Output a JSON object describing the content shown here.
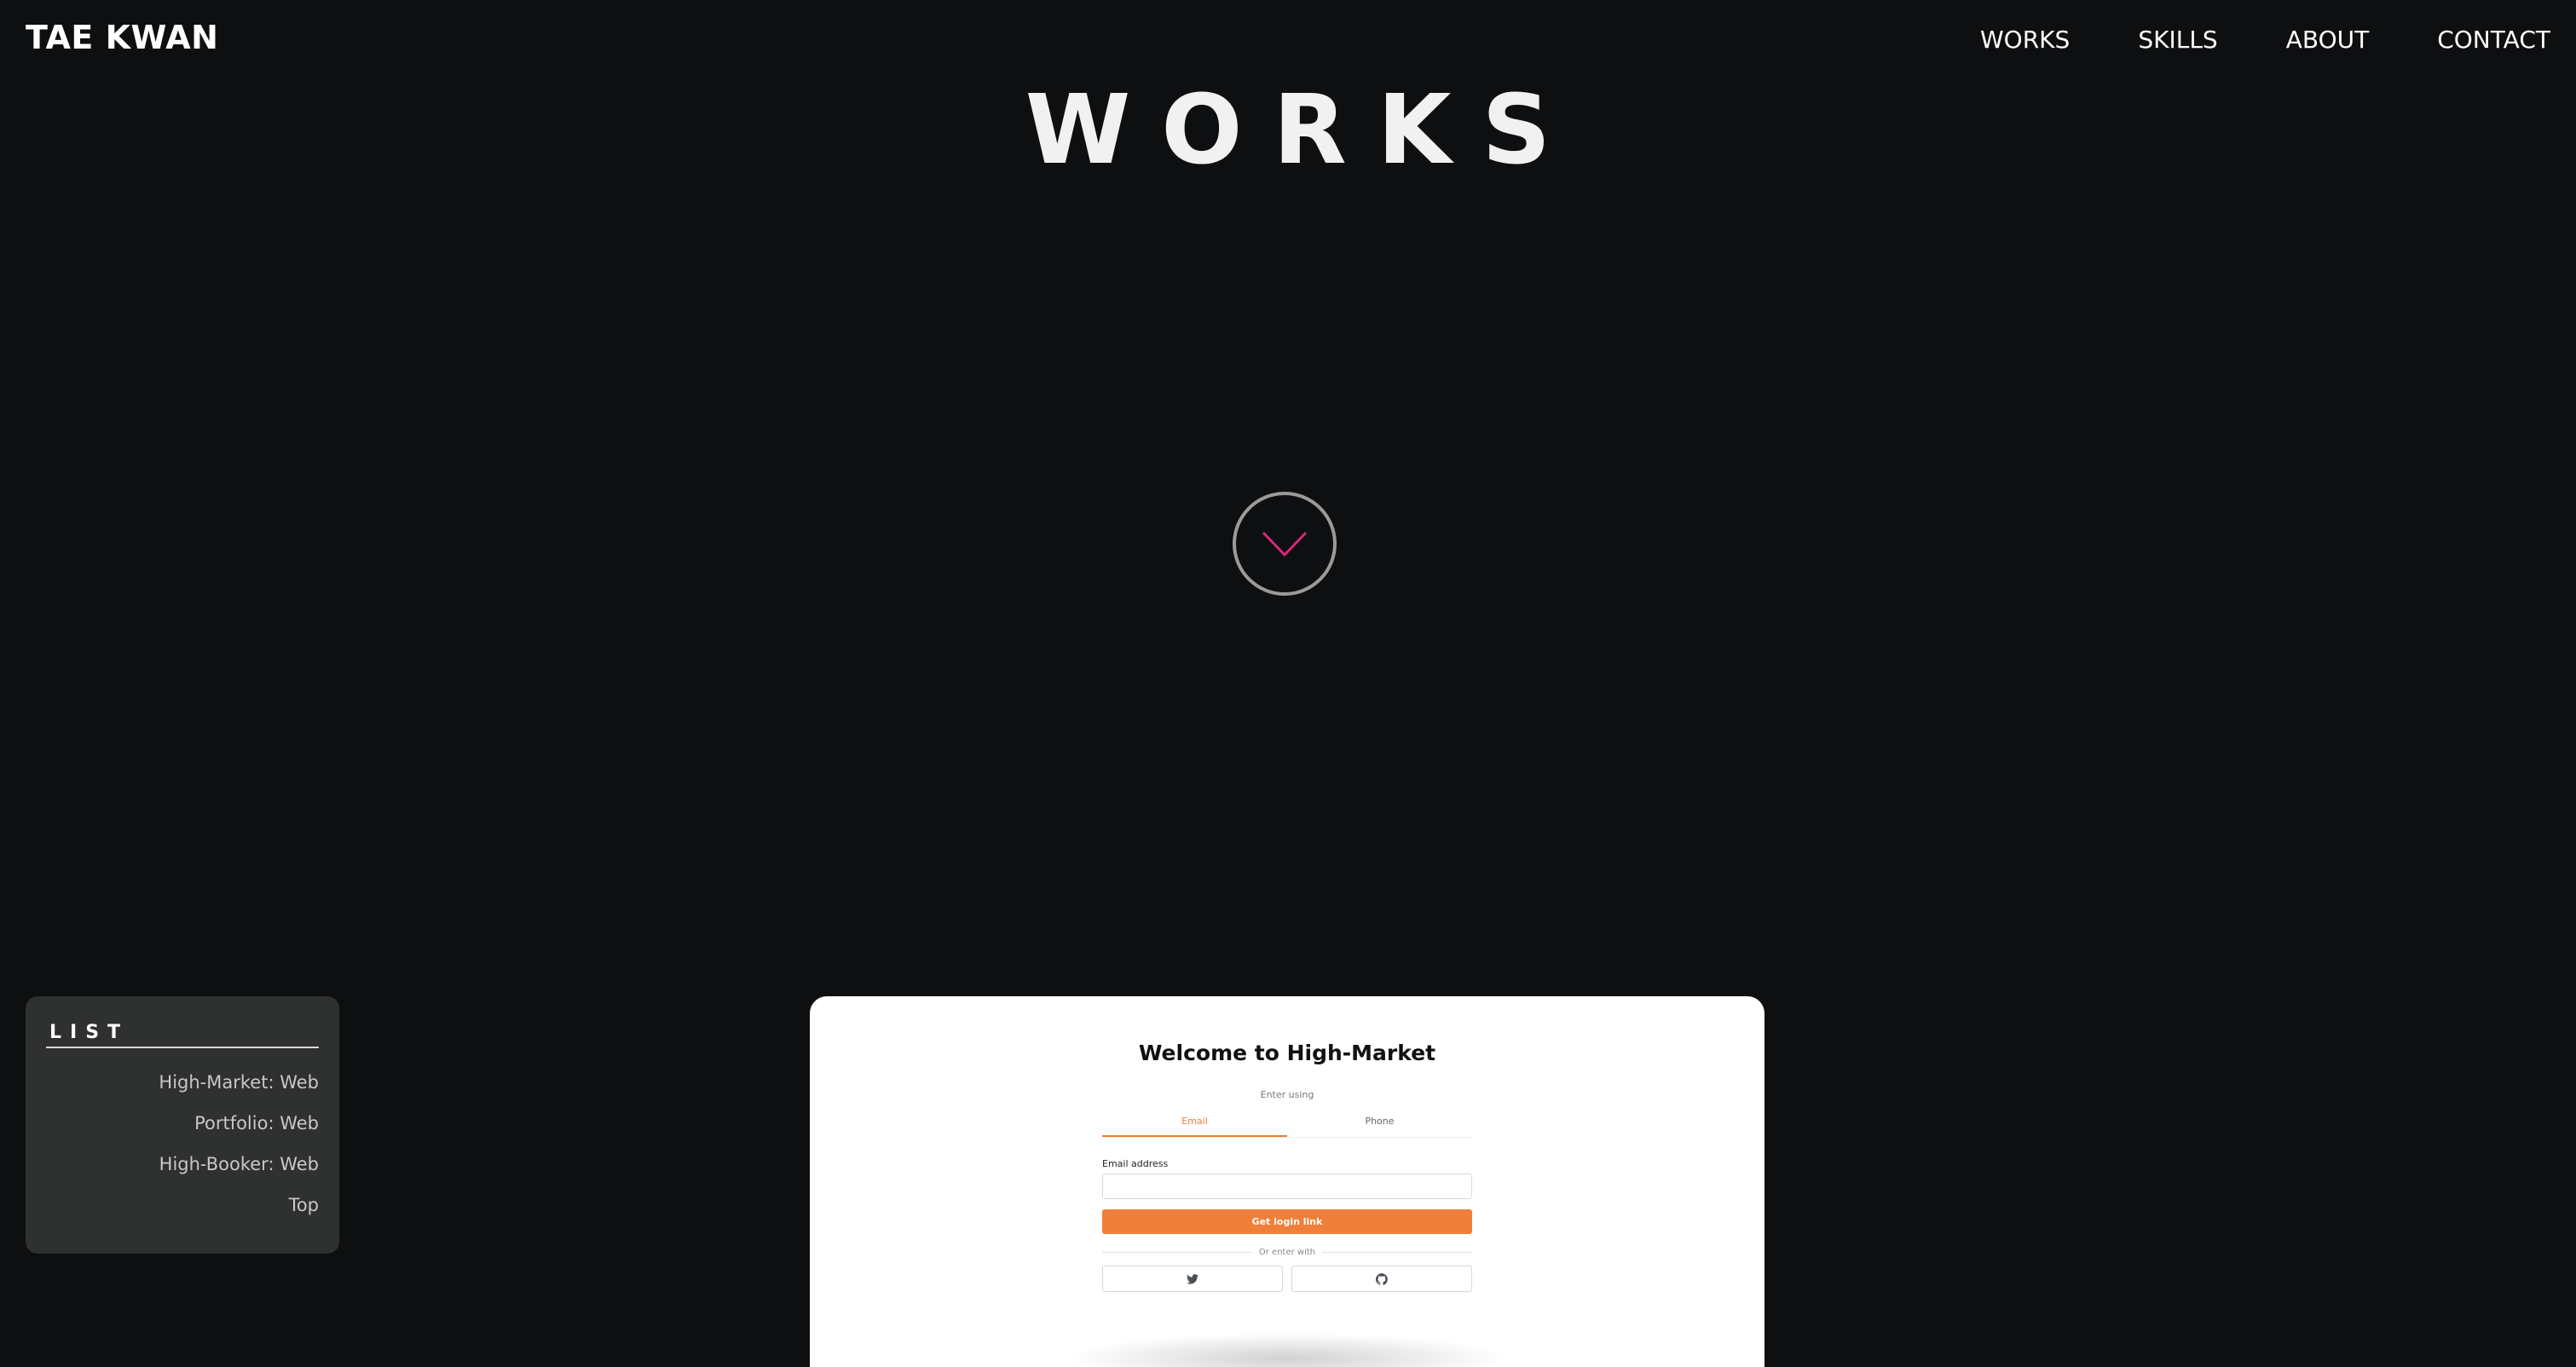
{
  "header": {
    "brand": "TAE KWAN",
    "nav": [
      "WORKS",
      "SKILLS",
      "ABOUT",
      "CONTACT"
    ]
  },
  "hero": {
    "title": "WORKS"
  },
  "list_panel": {
    "title": "LIST",
    "items": [
      "High-Market: Web",
      "Portfolio: Web",
      "High-Booker: Web",
      "Top"
    ]
  },
  "preview": {
    "title": "Welcome to High-Market",
    "enter_using": "Enter using",
    "tabs": [
      "Email",
      "Phone"
    ],
    "email_label": "Email address",
    "email_value": "",
    "login_button": "Get login link",
    "divider": "Or enter with",
    "social": [
      "twitter-icon",
      "github-icon"
    ]
  },
  "colors": {
    "background": "#0e0f11",
    "list_panel": "#2f3030",
    "accent_orange": "#ef7f3b",
    "chevron": "#d6287a"
  },
  "icons": {
    "scroll_down": "chevron-down-icon"
  }
}
